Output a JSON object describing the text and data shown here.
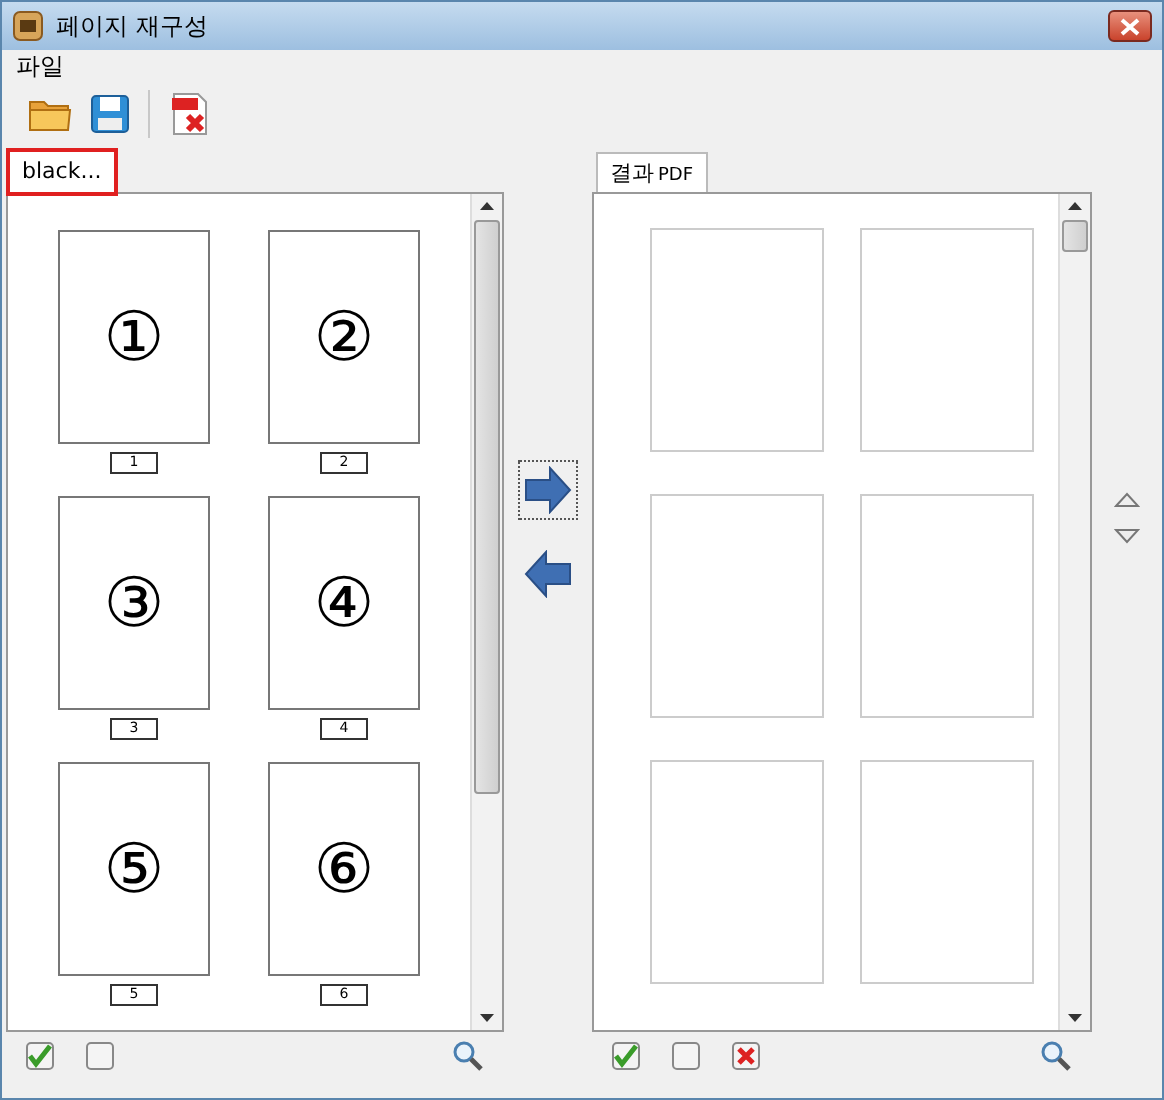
{
  "window": {
    "title": "페이지 재구성"
  },
  "menu": [
    "파일"
  ],
  "toolbar": [
    {
      "kind": "open"
    },
    {
      "kind": "save"
    },
    {
      "kind": "pdf-delete"
    }
  ],
  "source_tab": {
    "label": "black...",
    "highlighted": true
  },
  "source_pages": [
    {
      "symbol": "①",
      "number": "1"
    },
    {
      "symbol": "②",
      "number": "2"
    },
    {
      "symbol": "③",
      "number": "3"
    },
    {
      "symbol": "④",
      "number": "4"
    },
    {
      "symbol": "⑤",
      "number": "5"
    },
    {
      "symbol": "⑥",
      "number": "6"
    }
  ],
  "result_tab": {
    "label": "결과",
    "suffix": "PDF"
  },
  "result_pages": [
    {
      "kind": "blank"
    },
    {
      "kind": "blank"
    },
    {
      "kind": "blank"
    },
    {
      "kind": "blank"
    },
    {
      "kind": "blank"
    },
    {
      "kind": "blank"
    }
  ],
  "source_footer": [
    {
      "kind": "check-all"
    },
    {
      "kind": "uncheck"
    }
  ],
  "result_footer": [
    {
      "kind": "check-all"
    },
    {
      "kind": "uncheck"
    },
    {
      "kind": "delete"
    }
  ]
}
